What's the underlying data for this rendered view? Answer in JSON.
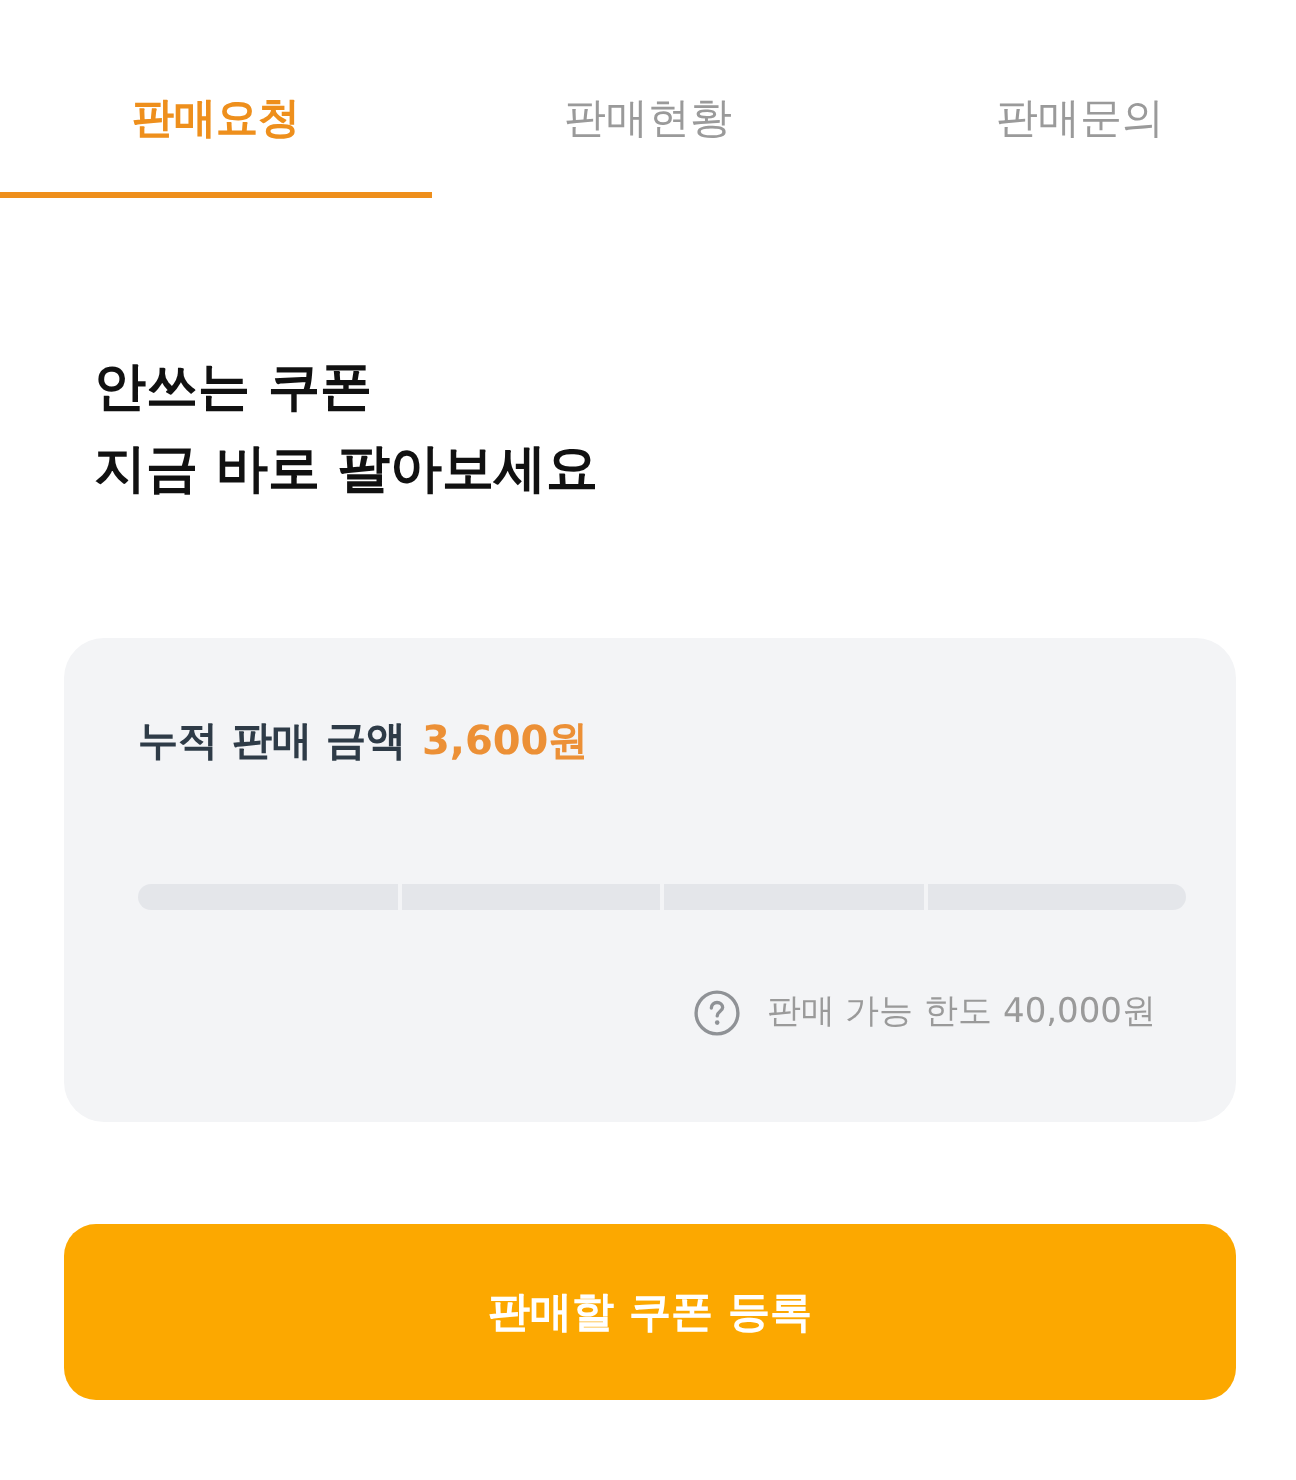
{
  "tabs": [
    {
      "label": "판매요청",
      "selected": true
    },
    {
      "label": "판매현황",
      "selected": false
    },
    {
      "label": "판매문의",
      "selected": false
    }
  ],
  "headline": "안쓰는 쿠폰\n지금 바로 팔아보세요",
  "summary": {
    "label": "누적 판매 금액",
    "amount": "3,600원",
    "progress_segments": [
      {
        "filled": false
      },
      {
        "filled": false
      },
      {
        "filled": false
      },
      {
        "filled": false
      }
    ],
    "limit_note": "판매 가능 한도 40,000원"
  },
  "button": {
    "label": "판매할 쿠폰 등록"
  }
}
